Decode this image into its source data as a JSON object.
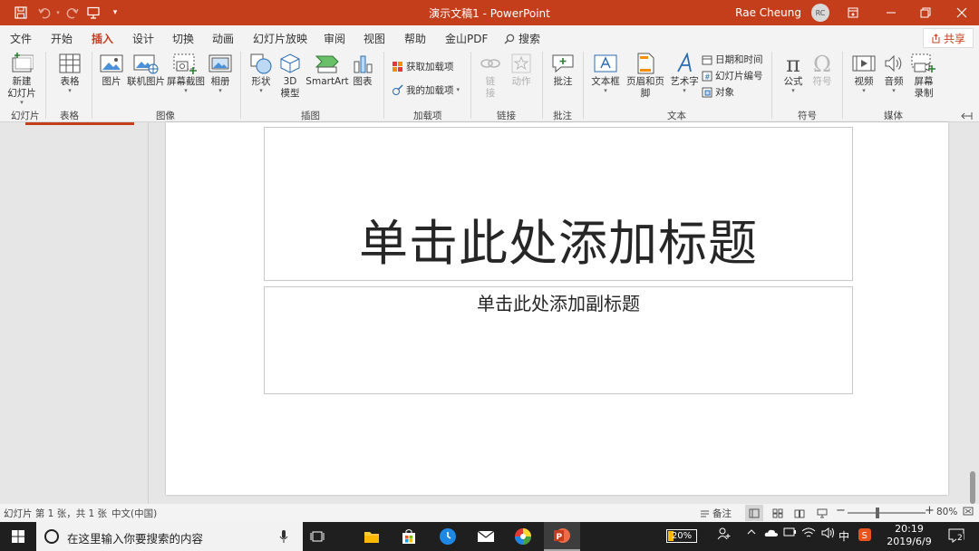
{
  "title_bar": {
    "document_title": "演示文稿1",
    "separator": "-",
    "app_name": "PowerPoint",
    "user_name": "Rae Cheung",
    "avatar_initials": "RC",
    "color": "#c43e1c"
  },
  "tabs": [
    {
      "label": "文件"
    },
    {
      "label": "开始"
    },
    {
      "label": "插入",
      "active": true
    },
    {
      "label": "设计"
    },
    {
      "label": "切换"
    },
    {
      "label": "动画"
    },
    {
      "label": "幻灯片放映"
    },
    {
      "label": "审阅"
    },
    {
      "label": "视图"
    },
    {
      "label": "帮助"
    },
    {
      "label": "金山PDF"
    },
    {
      "label": "搜索"
    }
  ],
  "share_label": "共享",
  "ribbon": {
    "new_slide": "新建\n幻灯片",
    "table": "表格",
    "picture": "图片",
    "online_picture": "联机图片",
    "screenshot": "屏幕截图",
    "album": "相册",
    "shapes": "形状",
    "model_3d": "3D\n模型",
    "smartart": "SmartArt",
    "chart": "图表",
    "get_addins": "获取加载项",
    "my_addins": "我的加载项",
    "link": "链\n接",
    "action": "动作",
    "comment": "批注",
    "textbox": "文本框",
    "header_footer": "页眉和页脚",
    "wordart": "艺术字",
    "date_time": "日期和时间",
    "slide_number": "幻灯片编号",
    "object": "对象",
    "equation": "公式",
    "symbol": "符号",
    "video": "视频",
    "audio": "音频",
    "screen_record": "屏幕\n录制",
    "groups": {
      "slides": "幻灯片",
      "tables": "表格",
      "images": "图像",
      "illustrations": "插图",
      "addins": "加载项",
      "links": "链接",
      "comments": "批注",
      "text": "文本",
      "symbols": "符号",
      "media": "媒体"
    }
  },
  "slide": {
    "title_placeholder": "单击此处添加标题",
    "subtitle_placeholder": "单击此处添加副标题"
  },
  "status_bar": {
    "slide_info": "幻灯片 第 1 张，共 1 张",
    "language": "中文(中国)",
    "notes": "备注",
    "zoom": "80%",
    "zoom_level": 0.8
  },
  "taskbar": {
    "search_placeholder": "在这里输入你要搜索的内容",
    "battery": "20%",
    "battery_level": 0.2,
    "ime": "中",
    "time": "20:19",
    "date": "2019/6/9",
    "notification_count": "2"
  }
}
